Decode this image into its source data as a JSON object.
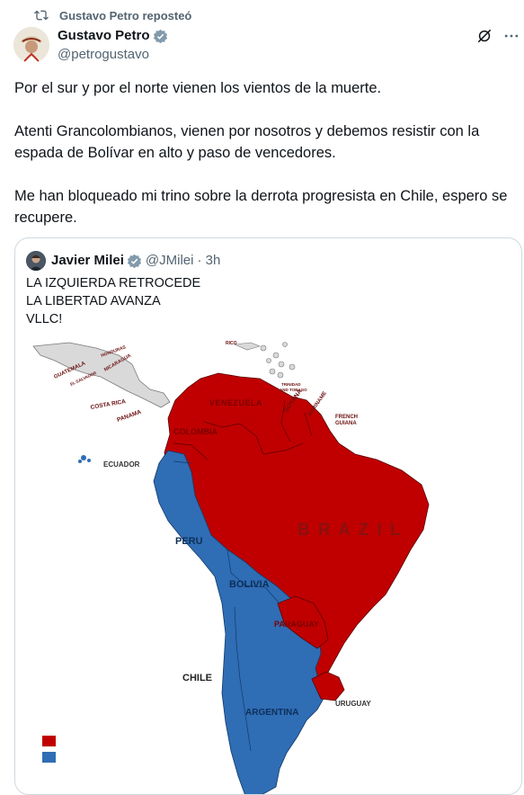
{
  "repost": {
    "label": "Gustavo Petro reposteó"
  },
  "author": {
    "name": "Gustavo Petro",
    "handle": "@petrogustavo"
  },
  "tweet": {
    "paragraphs": [
      "Por el sur y por el norte vienen los vientos de la muerte.",
      "Atenti Grancolombianos, vienen por nosotros y debemos resistir con la espada de Bolívar en alto y paso de vencedores.",
      "Me han bloqueado mi trino sobre la derrota progresista en Chile, espero se recupere."
    ]
  },
  "quote": {
    "name": "Javier Milei",
    "handle": "@JMilei",
    "time": "· 3h",
    "lines": [
      "LA IZQUIERDA RETROCEDE",
      "LA LIBERTAD AVANZA",
      "VLLC!"
    ]
  },
  "map": {
    "labels": {
      "ecuador": "ECUADOR",
      "peru": "PERU",
      "bolivia": "BOLIVIA",
      "paraguay": "PARAGUAY",
      "chile": "CHILE",
      "argentina": "ARGENTINA",
      "uruguay": "URUGUAY",
      "brazil": "B R A Z I L",
      "venezuela": "VENEZUELA",
      "colombia": "COLOMBIA",
      "guyana": "GUYANA",
      "suriname": "SURINAME",
      "french_guiana_1": "FRENCH",
      "french_guiana_2": "GUIANA",
      "costa_rica": "COSTA RICA",
      "panama": "PANAMA",
      "nicaragua": "NICARAGUA",
      "guatemala": "GUATEMALA",
      "honduras": "HONDURAS",
      "el_salvador": "EL SALVADOR",
      "trinidad_1": "TRINIDAD",
      "trinidad_2": "AND TOBAGO",
      "rico": "RICO"
    },
    "colors": {
      "red": "#c00000",
      "blue": "#2f6db5",
      "gray": "#d9d9d9"
    }
  }
}
